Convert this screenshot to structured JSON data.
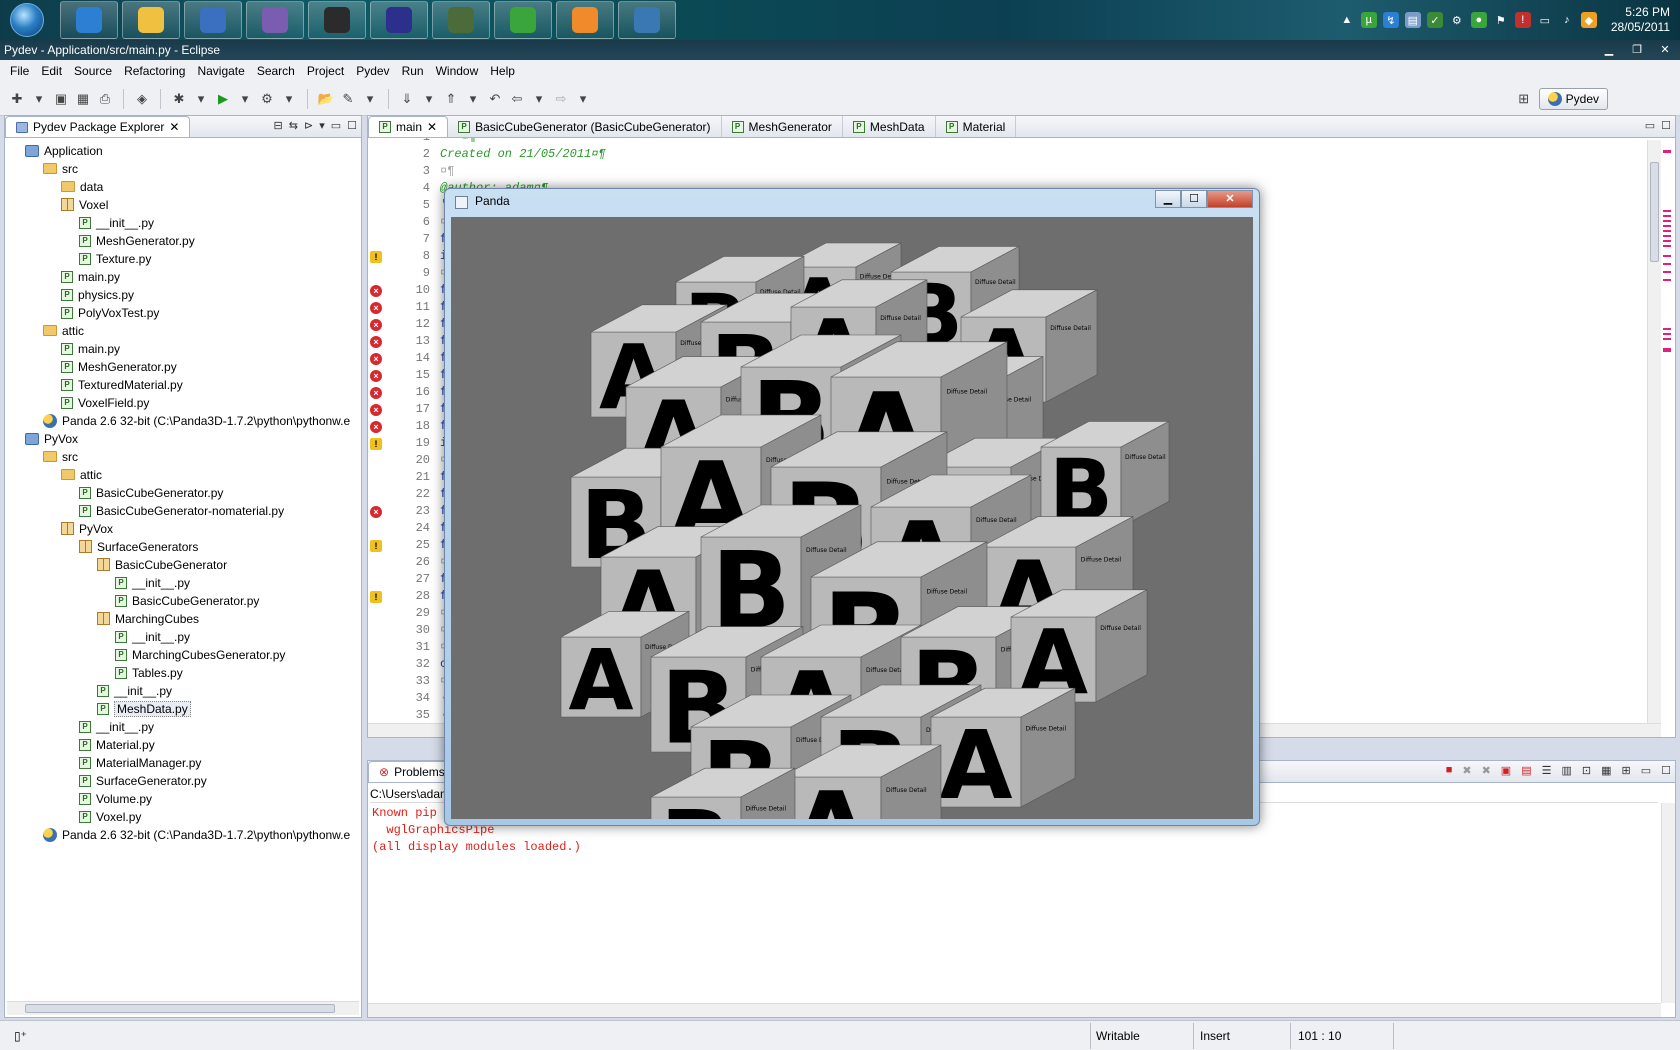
{
  "taskbar": {
    "apps": [
      {
        "name": "ie-icon",
        "color": "#2d7fd3"
      },
      {
        "name": "explorer-icon",
        "color": "#f0c040"
      },
      {
        "name": "firefox-icon",
        "color": "#3b6fc0"
      },
      {
        "name": "pidgin-icon",
        "color": "#7a5cb0"
      },
      {
        "name": "steam-icon",
        "color": "#2b2b2b"
      },
      {
        "name": "eclipse-icon",
        "color": "#2c2f8c"
      },
      {
        "name": "turtle-icon",
        "color": "#4b6b3a"
      },
      {
        "name": "utorrent-icon",
        "color": "#3aa53a"
      },
      {
        "name": "media-player-icon",
        "color": "#f08a2a"
      },
      {
        "name": "python-icon",
        "color": "#3a78b4"
      }
    ],
    "clock_time": "5:26 PM",
    "clock_date": "28/05/2011"
  },
  "window": {
    "title": "Pydev - Application/src/main.py - Eclipse"
  },
  "menu": [
    "File",
    "Edit",
    "Source",
    "Refactoring",
    "Navigate",
    "Search",
    "Project",
    "Pydev",
    "Run",
    "Window",
    "Help"
  ],
  "perspective": {
    "label": "Pydev"
  },
  "explorer": {
    "title": "Pydev Package Explorer",
    "items": [
      {
        "label": "Application",
        "kind": "proj",
        "depth": 0
      },
      {
        "label": "src",
        "kind": "fold",
        "depth": 1
      },
      {
        "label": "data",
        "kind": "fold",
        "depth": 2
      },
      {
        "label": "Voxel",
        "kind": "pkg",
        "depth": 2
      },
      {
        "label": "__init__.py",
        "kind": "py",
        "depth": 3
      },
      {
        "label": "MeshGenerator.py",
        "kind": "py",
        "depth": 3
      },
      {
        "label": "Texture.py",
        "kind": "py",
        "depth": 3
      },
      {
        "label": "main.py",
        "kind": "py",
        "depth": 2
      },
      {
        "label": "physics.py",
        "kind": "py",
        "depth": 2
      },
      {
        "label": "PolyVoxTest.py",
        "kind": "py",
        "depth": 2
      },
      {
        "label": "attic",
        "kind": "fold",
        "depth": 1
      },
      {
        "label": "main.py",
        "kind": "py",
        "depth": 2
      },
      {
        "label": "MeshGenerator.py",
        "kind": "py",
        "depth": 2
      },
      {
        "label": "TexturedMaterial.py",
        "kind": "py",
        "depth": 2
      },
      {
        "label": "VoxelField.py",
        "kind": "py",
        "depth": 2
      },
      {
        "label": "Panda 2.6 32-bit  (C:\\Panda3D-1.7.2\\python\\pythonw.e",
        "kind": "snake",
        "depth": 1
      },
      {
        "label": "PyVox",
        "kind": "proj",
        "depth": 0
      },
      {
        "label": "src",
        "kind": "fold",
        "depth": 1
      },
      {
        "label": "attic",
        "kind": "fold",
        "depth": 2
      },
      {
        "label": "BasicCubeGenerator.py",
        "kind": "py",
        "depth": 3
      },
      {
        "label": "BasicCubeGenerator-nomaterial.py",
        "kind": "py",
        "depth": 3
      },
      {
        "label": "PyVox",
        "kind": "pkg",
        "depth": 2
      },
      {
        "label": "SurfaceGenerators",
        "kind": "pkg",
        "depth": 3
      },
      {
        "label": "BasicCubeGenerator",
        "kind": "pkg",
        "depth": 4
      },
      {
        "label": "__init__.py",
        "kind": "py",
        "depth": 5
      },
      {
        "label": "BasicCubeGenerator.py",
        "kind": "py",
        "depth": 5
      },
      {
        "label": "MarchingCubes",
        "kind": "pkg",
        "depth": 4
      },
      {
        "label": "__init__.py",
        "kind": "py",
        "depth": 5
      },
      {
        "label": "MarchingCubesGenerator.py",
        "kind": "py",
        "depth": 5
      },
      {
        "label": "Tables.py",
        "kind": "py",
        "depth": 5
      },
      {
        "label": "__init__.py",
        "kind": "py",
        "depth": 4
      },
      {
        "label": "MeshData.py",
        "kind": "py",
        "depth": 4
      },
      {
        "label": "__init__.py",
        "kind": "py",
        "depth": 3
      },
      {
        "label": "Material.py",
        "kind": "py",
        "depth": 3
      },
      {
        "label": "MaterialManager.py",
        "kind": "py",
        "depth": 3
      },
      {
        "label": "SurfaceGenerator.py",
        "kind": "py",
        "depth": 3
      },
      {
        "label": "Volume.py",
        "kind": "py",
        "depth": 3
      },
      {
        "label": "Voxel.py",
        "kind": "py",
        "depth": 3
      },
      {
        "label": "Panda 2.6 32-bit  (C:\\Panda3D-1.7.2\\python\\pythonw.e",
        "kind": "snake",
        "depth": 1
      }
    ]
  },
  "editor": {
    "tabs": [
      "main",
      "BasicCubeGenerator (BasicCubeGenerator)",
      "MeshGenerator",
      "MeshData",
      "Material"
    ],
    "lines": [
      {
        "n": "1",
        "text": "'''¤¶",
        "mark": "",
        "color": "#1a7f1a"
      },
      {
        "n": "2",
        "text": "Created on 21/05/2011¤¶",
        "mark": "",
        "color": "#2a9a2a"
      },
      {
        "n": "3",
        "text": "¤¶",
        "mark": "",
        "color": "#aaa"
      },
      {
        "n": "4",
        "text": "@author: adam¤¶",
        "mark": "",
        "color": "#2a9a2a"
      },
      {
        "n": "5",
        "text": "'''¤¶",
        "mark": "",
        "color": "#2a9a2a"
      },
      {
        "n": "6",
        "text": "¤¶",
        "mark": "",
        "color": "#aaa"
      },
      {
        "n": "7",
        "text": "from",
        "mark": "",
        "color": "#1a3ab0"
      },
      {
        "n": "8",
        "text": "impo",
        "mark": "warn",
        "color": "#1a3ab0"
      },
      {
        "n": "9",
        "text": "¤¶",
        "mark": "",
        "color": "#aaa"
      },
      {
        "n": "10",
        "text": "from",
        "mark": "err",
        "color": "#1a3ab0"
      },
      {
        "n": "11",
        "text": "from",
        "mark": "err",
        "color": "#1a3ab0"
      },
      {
        "n": "12",
        "text": "from",
        "mark": "err",
        "color": "#1a3ab0"
      },
      {
        "n": "13",
        "text": "from",
        "mark": "err",
        "color": "#1a3ab0"
      },
      {
        "n": "14",
        "text": "from",
        "mark": "err",
        "color": "#1a3ab0"
      },
      {
        "n": "15",
        "text": "from",
        "mark": "err",
        "color": "#1a3ab0"
      },
      {
        "n": "16",
        "text": "from",
        "mark": "err",
        "color": "#1a3ab0"
      },
      {
        "n": "17",
        "text": "from",
        "mark": "err",
        "color": "#1a3ab0"
      },
      {
        "n": "18",
        "text": "from",
        "mark": "err",
        "color": "#1a3ab0"
      },
      {
        "n": "19",
        "text": "impo",
        "mark": "warn",
        "color": "#1a3ab0"
      },
      {
        "n": "20",
        "text": "¤¶",
        "mark": "",
        "color": "#aaa"
      },
      {
        "n": "21",
        "text": "from",
        "mark": "",
        "color": "#1a3ab0"
      },
      {
        "n": "22",
        "text": "from",
        "mark": "",
        "color": "#1a3ab0"
      },
      {
        "n": "23",
        "text": "from",
        "mark": "err",
        "color": "#1a3ab0"
      },
      {
        "n": "24",
        "text": "from",
        "mark": "",
        "color": "#1a3ab0"
      },
      {
        "n": "25",
        "text": "from",
        "mark": "warn",
        "color": "#1a3ab0"
      },
      {
        "n": "26",
        "text": "¤¶",
        "mark": "",
        "color": "#aaa"
      },
      {
        "n": "27",
        "text": "from",
        "mark": "",
        "color": "#1a3ab0"
      },
      {
        "n": "28",
        "text": "from",
        "mark": "warn",
        "color": "#1a3ab0"
      },
      {
        "n": "29",
        "text": "¤¶",
        "mark": "",
        "color": "#aaa"
      },
      {
        "n": "30",
        "text": "¤¶",
        "mark": "",
        "color": "#aaa"
      },
      {
        "n": "31",
        "text": "¤¶",
        "mark": "",
        "color": "#aaa"
      },
      {
        "n": "32",
        "text": "clas",
        "mark": "",
        "color": "#1a3ab0"
      },
      {
        "n": "33",
        "text": "¤¶",
        "mark": "",
        "color": "#aaa"
      },
      {
        "n": "34",
        "text": "····",
        "mark": "",
        "color": "#aaa"
      },
      {
        "n": "35",
        "text": "····",
        "mark": "",
        "color": "#aaa"
      }
    ]
  },
  "panda": {
    "title": "Panda",
    "cube_letters": [
      "A",
      "B"
    ],
    "cube_face_text": "Diffuse Detail"
  },
  "console": {
    "tab": "Problems",
    "path": "C:\\Users\\adam",
    "output": [
      "Known pip",
      "  wglGraphicsPipe",
      "(all display modules loaded.)"
    ]
  },
  "status": {
    "writable": "Writable",
    "insert": "Insert",
    "position": "101 : 10"
  }
}
